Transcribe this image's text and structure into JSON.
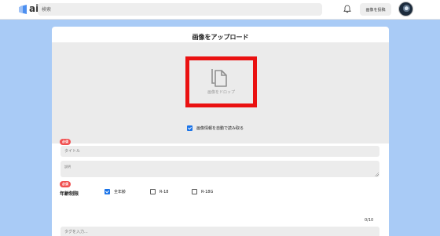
{
  "header": {
    "logo_text": "aivy",
    "logo_icon": "aivy-logo-icon",
    "search_placeholder": "検索",
    "bell_icon": "bell-icon",
    "upload_button_label": "画像を投稿",
    "avatar_icon": "user-avatar"
  },
  "upload": {
    "title": "画像をアップロード",
    "drop_icon": "file-copy-icon",
    "drop_label": "画像をドロップ",
    "highlight_color": "#ea1111",
    "auto_read": {
      "label": "画像情報を自動で読み取る",
      "checked": true
    },
    "required_badge": "必須",
    "title_placeholder": "タイトル",
    "description_placeholder": "説明",
    "age_rating": {
      "label": "年齢制限",
      "options": [
        {
          "label": "全年齢",
          "checked": true
        },
        {
          "label": "R-18",
          "checked": false
        },
        {
          "label": "R-18G",
          "checked": false
        }
      ]
    },
    "tag_counter": "0/10",
    "tag_placeholder": "タグを入力..."
  },
  "colors": {
    "background": "#a9cbf6",
    "checkbox_accent": "#1a73e8",
    "required_badge": "#f05050",
    "logo_accent": "#4c8ff0"
  }
}
